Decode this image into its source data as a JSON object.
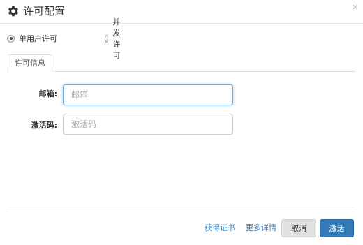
{
  "dialog": {
    "title": "许可配置",
    "title_icon": "gear-icon",
    "close_glyph": "×"
  },
  "license_type": {
    "options": [
      {
        "label": "单用户许可",
        "checked": true
      },
      {
        "label": "并发许可",
        "checked": false
      }
    ]
  },
  "tabs": [
    {
      "label": "许可信息",
      "active": true
    }
  ],
  "form": {
    "email": {
      "label": "邮箱:",
      "placeholder": "邮箱",
      "value": ""
    },
    "activation_code": {
      "label": "激活码:",
      "placeholder": "激活码",
      "value": ""
    }
  },
  "footer": {
    "get_certificate_link": "获得证书",
    "more_details_link": "更多详情",
    "cancel_label": "取消",
    "activate_label": "激活"
  },
  "colors": {
    "primary": "#337ab7",
    "link": "#337ab7",
    "cancel_bg": "#e0e0e0",
    "focus_border": "#66afe9"
  }
}
